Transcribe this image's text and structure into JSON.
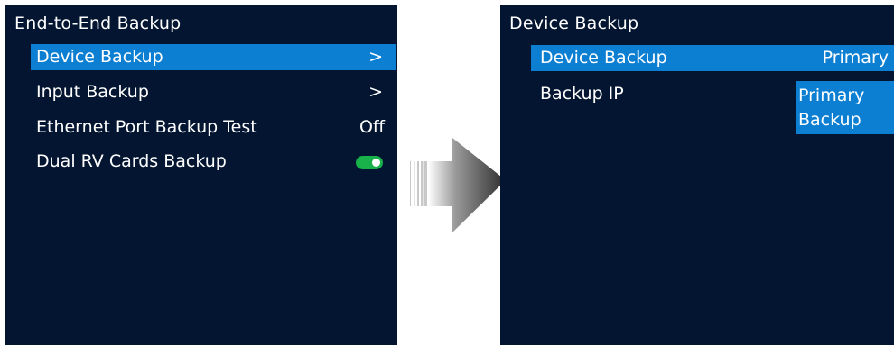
{
  "left_screen": {
    "title": "End-to-End Backup",
    "items": [
      {
        "label": "Device Backup",
        "indicator": ">"
      },
      {
        "label": "Input Backup",
        "indicator": ">"
      },
      {
        "label": "Ethernet Port Backup Test",
        "value": "Off"
      },
      {
        "label": "Dual RV Cards Backup",
        "toggle": "on"
      }
    ]
  },
  "right_screen": {
    "title": "Device Backup",
    "items": [
      {
        "label": "Device Backup",
        "value": "Primary"
      },
      {
        "label": "Backup IP"
      }
    ],
    "dropdown_options": [
      "Primary",
      "Backup"
    ]
  },
  "colors": {
    "screen_background": "#031530",
    "selection": "#0c7fd2",
    "toggle_on": "#18b14a"
  },
  "icons": {
    "submenu": "chevron-right-icon",
    "transition": "right-arrow-icon"
  }
}
